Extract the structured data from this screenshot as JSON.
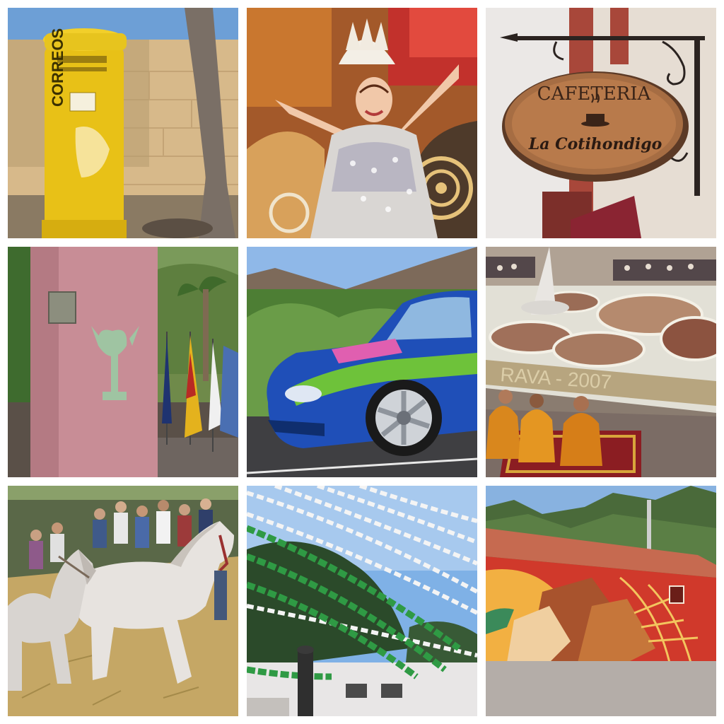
{
  "collage": {
    "tiles": [
      {
        "id": "postbox",
        "label_vertical": "CORREOS"
      },
      {
        "id": "carnival-queen"
      },
      {
        "id": "cafeteria-sign",
        "title": "CAFETERIA",
        "subtitle": "La Cotihondigo"
      },
      {
        "id": "monument-flags"
      },
      {
        "id": "rally-car"
      },
      {
        "id": "sand-carpet",
        "carpet_text": "RAVA - 2007"
      },
      {
        "id": "horses"
      },
      {
        "id": "street-garlands"
      },
      {
        "id": "mural-building"
      }
    ]
  }
}
